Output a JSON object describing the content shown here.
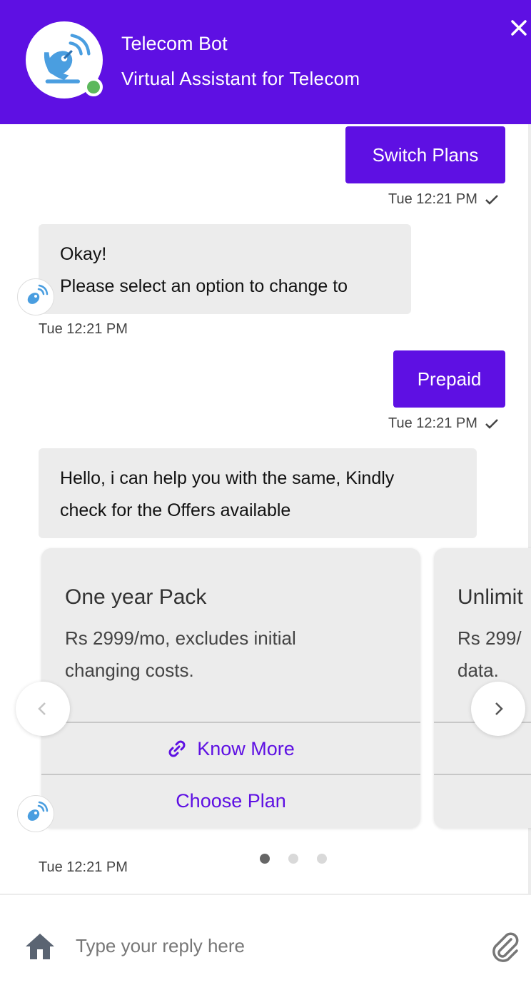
{
  "header": {
    "title": "Telecom Bot",
    "subtitle": "Virtual Assistant for Telecom",
    "status": "online",
    "status_color": "#5cb85c",
    "accent_color": "#5e10e3",
    "avatar_icon": "satellite-dish-icon",
    "close_icon": "close-icon"
  },
  "messages": [
    {
      "from": "user",
      "text": "Switch Plans",
      "time": "Tue 12:21 PM",
      "delivered": true
    },
    {
      "from": "bot",
      "lines": [
        "Okay!",
        "Please select an option to change to"
      ],
      "time": "Tue 12:21 PM"
    },
    {
      "from": "user",
      "text": "Prepaid",
      "time": "Tue 12:21 PM",
      "delivered": true
    },
    {
      "from": "bot",
      "lines": [
        "Hello, i can help you with the same, Kindly",
        "check for the Offers available"
      ]
    }
  ],
  "carousel": {
    "cards": [
      {
        "title": "One year Pack",
        "desc_lines": [
          "Rs 2999/mo, excludes initial",
          "changing costs."
        ],
        "know_more": "Know More",
        "choose": "Choose Plan"
      },
      {
        "title": "Unlimit",
        "desc_lines": [
          "Rs 299/",
          "data."
        ]
      }
    ],
    "time": "Tue 12:21 PM",
    "active_page": 1,
    "page_count": 3
  },
  "composer": {
    "placeholder": "Type your reply here",
    "home_icon": "home-icon",
    "attach_icon": "paperclip-icon"
  }
}
